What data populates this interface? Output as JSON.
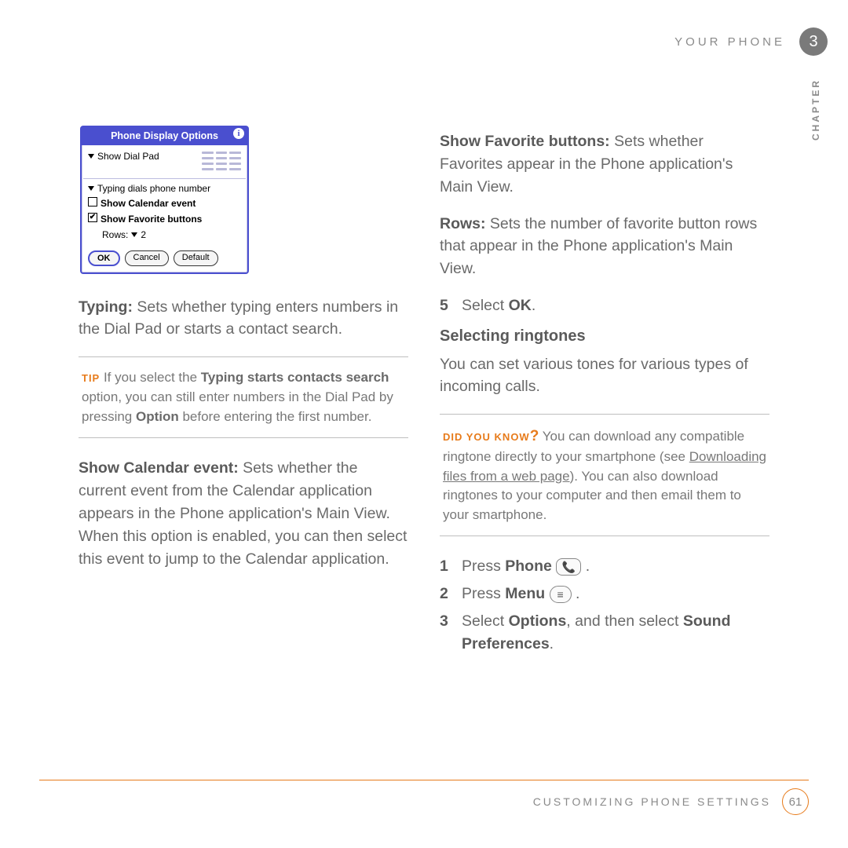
{
  "header": {
    "running": "YOUR PHONE",
    "chapter_num": "3",
    "chapter_word": "CHAPTER"
  },
  "dialog": {
    "title": "Phone Display Options",
    "row_show_dial": "Show Dial Pad",
    "row_typing": "Typing dials phone number",
    "row_cal": "Show Calendar event",
    "row_fav": "Show Favorite buttons",
    "rows_label": "Rows:",
    "rows_val": "2",
    "btn_ok": "OK",
    "btn_cancel": "Cancel",
    "btn_default": "Default"
  },
  "left": {
    "typing_label": "Typing:",
    "typing_body": " Sets whether typing enters numbers in the Dial Pad or starts a contact search.",
    "tip_label": "TIP",
    "tip_a": "  If you select the ",
    "tip_b": "Typing starts contacts search",
    "tip_c": " option, you can still enter numbers in the Dial Pad by pressing ",
    "tip_d": "Option",
    "tip_e": " before entering the first number.",
    "cal_label": "Show Calendar event:",
    "cal_body": " Sets whether the current event from the Calendar application appears in the Phone application's Main View. When this option is enabled, you can then select this event to jump to the Calendar application."
  },
  "right": {
    "fav_label": "Show Favorite buttons:",
    "fav_body": " Sets whether Favorites appear in the Phone application's Main View.",
    "rows_label": "Rows:",
    "rows_body": " Sets the number of favorite button rows that appear in the Phone application's Main View.",
    "step5_num": "5",
    "step5_a": "Select ",
    "step5_b": "OK",
    "step5_c": ".",
    "section": "Selecting ringtones",
    "section_body": "You can set various tones for various types of incoming calls.",
    "dyk_label": "DID YOU KNOW",
    "dyk_q": "?",
    "dyk_a": "  You can download any compatible ringtone directly to your smartphone (see ",
    "dyk_link": "Downloading files from a web page",
    "dyk_b": "). You can also download ringtones to your computer and then email them to your smartphone.",
    "s1_num": "1",
    "s1_a": "Press ",
    "s1_b": "Phone",
    "s1_c": " .",
    "s2_num": "2",
    "s2_a": "Press ",
    "s2_b": "Menu",
    "s2_c": " .",
    "s3_num": "3",
    "s3_a": "Select ",
    "s3_b": "Options",
    "s3_c": ", and then select ",
    "s3_d": "Sound Preferences",
    "s3_e": "."
  },
  "footer": {
    "text": "CUSTOMIZING PHONE SETTINGS",
    "page": "61"
  },
  "icons": {
    "phone": "📞",
    "menu": "≡"
  }
}
